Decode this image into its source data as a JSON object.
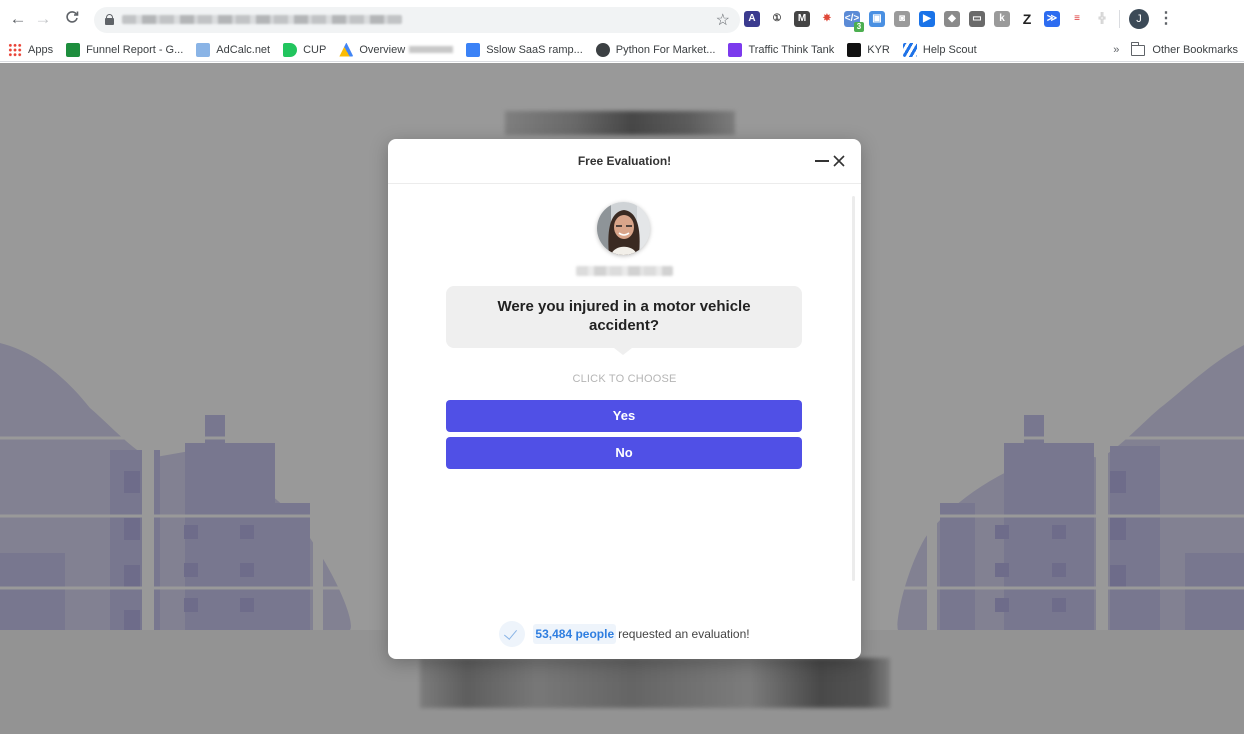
{
  "browser": {
    "nav": {
      "back": "←",
      "forward": "→",
      "reload": "C"
    },
    "url_redacted": true,
    "bookmark_star": "☆",
    "extensions": [
      {
        "name": "ahrefs-icon",
        "glyph": "A",
        "color": "#3b3b8f"
      },
      {
        "name": "onepassword-icon",
        "glyph": "①",
        "color": "#444444"
      },
      {
        "name": "m-extension-icon",
        "glyph": "M",
        "color": "#444444"
      },
      {
        "name": "colorzilla-icon",
        "glyph": "✸",
        "color": "#e04a3a"
      },
      {
        "name": "code-extension-icon",
        "glyph": "</>",
        "color": "#5b8bd6",
        "badge": "3"
      },
      {
        "name": "screen-capture-icon",
        "glyph": "▣",
        "color": "#4a90e2"
      },
      {
        "name": "camera-icon",
        "glyph": "◙",
        "color": "#9a9a9a"
      },
      {
        "name": "video-icon",
        "glyph": "▶",
        "color": "#1a73e8"
      },
      {
        "name": "puzzle-icon",
        "glyph": "◆",
        "color": "#8a8a8a"
      },
      {
        "name": "cast-icon",
        "glyph": "▭",
        "color": "#6a6a6a"
      },
      {
        "name": "k-extension-icon",
        "glyph": "k",
        "color": "#9a9a9a"
      },
      {
        "name": "z-extension-icon",
        "glyph": "Z",
        "color": "#222222"
      },
      {
        "name": "arrow-extension-icon",
        "glyph": "≫",
        "color": "#2d6cf0"
      },
      {
        "name": "lines-extension-icon",
        "glyph": "≡",
        "color": "#d33"
      },
      {
        "name": "grid-extension-icon",
        "glyph": "╬",
        "color": "#b0b0b0"
      }
    ],
    "profile_initial": "J",
    "menu": "⋮",
    "bookmarks": [
      {
        "label": "Apps",
        "icon": "apps-grid-icon",
        "color": "#e94235"
      },
      {
        "label": "Funnel Report - G...",
        "icon": "sheets-icon",
        "color": "#1e8e3e"
      },
      {
        "label": "AdCalc.net",
        "icon": "adcalc-icon",
        "color": "#8ab4e6"
      },
      {
        "label": "CUP",
        "icon": "cup-icon",
        "color": "#22c55e"
      },
      {
        "label": "Overview",
        "icon": "google-ads-icon",
        "color": "#fbbc04",
        "redacted_suffix": true
      },
      {
        "label": "Sslow SaaS ramp...",
        "icon": "sslow-icon",
        "color": "#3b82f6"
      },
      {
        "label": "Python For Market...",
        "icon": "globe-icon",
        "color": "#3c4043"
      },
      {
        "label": "Traffic Think Tank",
        "icon": "traffic-think-tank-icon",
        "color": "#7c3aed"
      },
      {
        "label": "KYR",
        "icon": "kyr-icon",
        "color": "#111111"
      },
      {
        "label": "Help Scout",
        "icon": "help-scout-icon",
        "color": "#1f73e8"
      }
    ],
    "more_bookmarks": "»",
    "other_bookmarks": "Other Bookmarks"
  },
  "modal": {
    "title": "Free Evaluation!",
    "minimize_label": "",
    "close_label": "✕",
    "agent_name_redacted": true,
    "question": "Were you injured in a motor vehicle accident?",
    "hint": "CLICK TO CHOOSE",
    "options": [
      {
        "label": "Yes"
      },
      {
        "label": "No"
      }
    ],
    "social_proof": {
      "count": "53,484 people",
      "text": "requested an evaluation!"
    },
    "colors": {
      "button": "#5050e6",
      "count_text": "#2f7ee0"
    }
  }
}
